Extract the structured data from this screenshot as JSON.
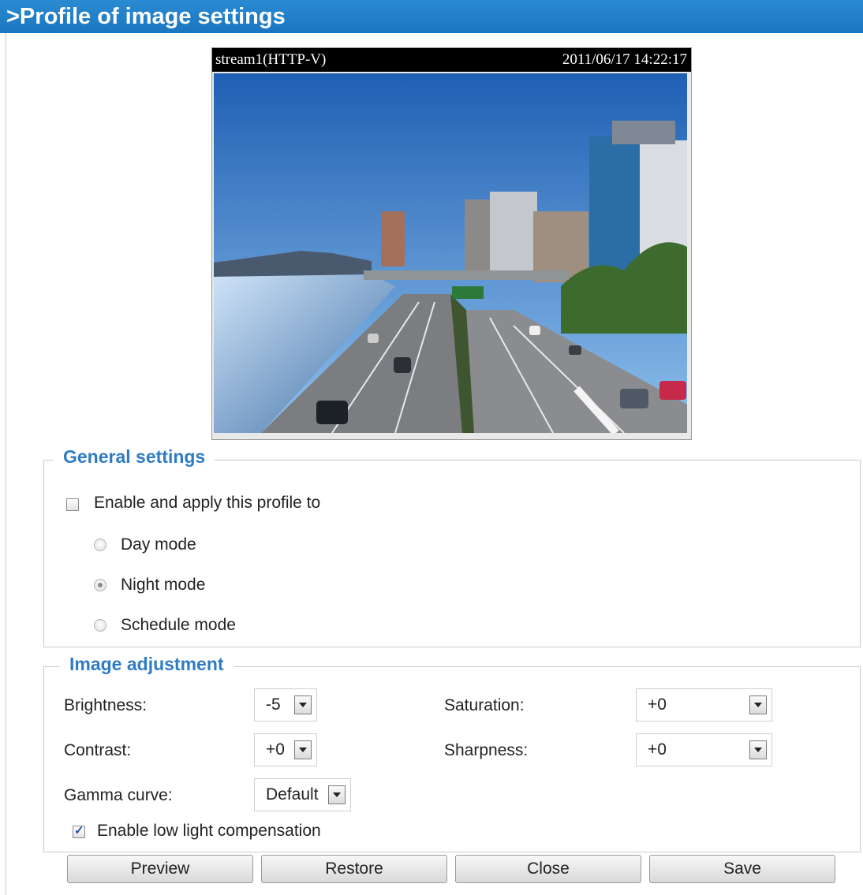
{
  "title": ">Profile of image settings",
  "video": {
    "stream_label": "stream1(HTTP-V)",
    "timestamp": "2011/06/17 14:22:17"
  },
  "general": {
    "legend": "General settings",
    "enable_label": "Enable and apply this profile to",
    "enable_checked": false,
    "modes": [
      {
        "label": "Day mode",
        "selected": false
      },
      {
        "label": "Night mode",
        "selected": true
      },
      {
        "label": "Schedule mode",
        "selected": false
      }
    ]
  },
  "image_adjustment": {
    "legend": "Image adjustment",
    "brightness": {
      "label": "Brightness:",
      "value": "-5"
    },
    "contrast": {
      "label": "Contrast:",
      "value": "+0"
    },
    "gamma": {
      "label": "Gamma curve:",
      "value": "Default"
    },
    "saturation": {
      "label": "Saturation:",
      "value": "+0"
    },
    "sharpness": {
      "label": "Sharpness:",
      "value": "+0"
    },
    "low_light": {
      "label": "Enable low light compensation",
      "checked": true
    }
  },
  "buttons": {
    "preview": "Preview",
    "restore": "Restore",
    "close": "Close",
    "save": "Save"
  },
  "colors": {
    "title_bar": "#1a76c0",
    "legend_text": "#2f7cc4"
  }
}
